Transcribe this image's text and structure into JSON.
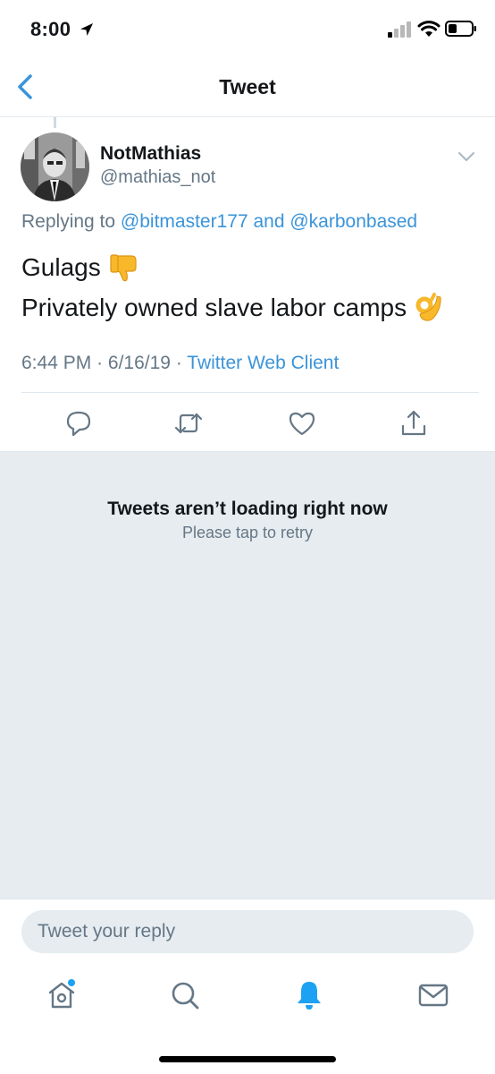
{
  "status_bar": {
    "time": "8:00",
    "icons": [
      "location-arrow-icon",
      "signal-icon",
      "wifi-icon",
      "battery-icon"
    ]
  },
  "nav": {
    "title": "Tweet",
    "back_icon": "chevron-left-icon"
  },
  "tweet": {
    "display_name": "NotMathias",
    "handle": "@mathias_not",
    "replying_prefix": "Replying to",
    "replying_user1": "@bitmaster177",
    "replying_and": "and",
    "replying_user2": "@karbonbased",
    "text_line1": "Gulags",
    "text_line1_emoji": "thumbs-down-emoji",
    "text_line2": "Privately owned slave labor camps",
    "text_line2_emoji": "ok-hand-emoji",
    "time": "6:44 PM",
    "date": "6/16/19",
    "client": "Twitter Web Client",
    "actions": [
      "reply-icon",
      "retweet-icon",
      "like-icon",
      "share-icon"
    ]
  },
  "error": {
    "title": "Tweets aren’t loading right now",
    "subtitle": "Please tap to retry"
  },
  "reply": {
    "placeholder": "Tweet your reply"
  },
  "tabbar": {
    "items": [
      "home-icon",
      "search-icon",
      "notifications-icon",
      "messages-icon"
    ],
    "active": "notifications-icon"
  },
  "colors": {
    "accent": "#1da1f2",
    "link": "#3b94d9",
    "secondary_text": "#657786",
    "error_bg": "#e6ecf0"
  }
}
